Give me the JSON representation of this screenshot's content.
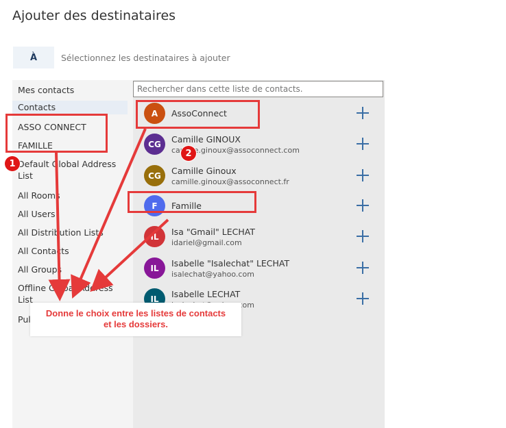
{
  "dialog": {
    "title": "Ajouter des destinataires",
    "to_label": "À",
    "to_placeholder": "Sélectionnez les destinataires à ajouter"
  },
  "sidebar": {
    "items": [
      {
        "label": "Mes contacts"
      },
      {
        "label": "Contacts"
      },
      {
        "label": "ASSO CONNECT"
      },
      {
        "label": "FAMILLE"
      },
      {
        "label": "Default Global Address List"
      },
      {
        "label": "All Rooms"
      },
      {
        "label": "All Users"
      },
      {
        "label": "All Distribution Lists"
      },
      {
        "label": "All Contacts"
      },
      {
        "label": "All Groups"
      },
      {
        "label": "Offline Global Address List"
      },
      {
        "label": "Pul"
      }
    ]
  },
  "search": {
    "placeholder": "Rechercher dans cette liste de contacts."
  },
  "contacts": [
    {
      "initials": "A",
      "name": "AssoConnect",
      "email": "",
      "color": "#ca5010"
    },
    {
      "initials": "CG",
      "name": "Camille GINOUX",
      "email": "camille.ginoux@assoconnect.com",
      "color": "#5c2e91"
    },
    {
      "initials": "CG",
      "name": "Camille Ginoux",
      "email": "camille.ginoux@assoconnect.fr",
      "color": "#986f0b"
    },
    {
      "initials": "F",
      "name": "Famille",
      "email": "",
      "color": "#4f6bed"
    },
    {
      "initials": "IL",
      "name": "Isa \"Gmail\" LECHAT",
      "email": "idariel@gmail.com",
      "color": "#d13438"
    },
    {
      "initials": "IL",
      "name": "Isabelle \"Isalechat\" LECHAT",
      "email": "isalechat@yahoo.com",
      "color": "#881798"
    },
    {
      "initials": "IL",
      "name": "Isabelle LECHAT",
      "email": "isalechat@yahoo.com",
      "color": "#005b70"
    }
  ],
  "annotations": {
    "badge1": "1",
    "badge2": "2",
    "callout_line1": "Donne le choix entre les listes de contacts",
    "callout_line2": "et les dossiers.",
    "color": "#e53a3a"
  },
  "icons": {
    "add": "plus-icon"
  }
}
